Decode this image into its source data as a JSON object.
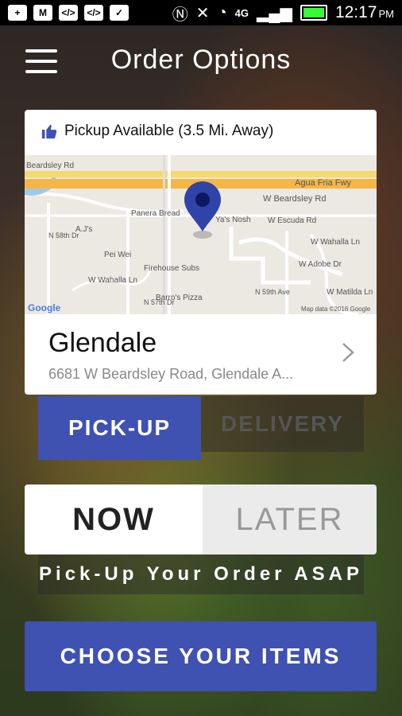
{
  "status_bar": {
    "time": "12:17",
    "ampm": "PM",
    "network": "4G"
  },
  "header": {
    "title": "Order Options",
    "menu_icon": "hamburger-menu-icon"
  },
  "location_card": {
    "pickup_status": "Pickup Available (3.5 Mi. Away)",
    "store_name": "Glendale",
    "store_address": "6681 W Beardsley Road, Glendale A...",
    "map": {
      "streets": [
        "Beardsley Rd",
        "Agua Fria Fwy",
        "W Beardsley Rd",
        "W Escuda Rd",
        "W Wahalla Ln",
        "W Adobe Dr",
        "W Matilda Ln",
        "N 59th Ave",
        "N 57th Dr",
        "N 58th Dr",
        "W Wahalla Ln"
      ],
      "places": [
        "Panera Bread",
        "Pei Wei",
        "A.J's",
        "Firehouse Subs",
        "Barro's Pizza",
        "Ya's Nosh"
      ],
      "attribution": "Map data ©2016 Google",
      "logo": "Google"
    }
  },
  "fulfillment": {
    "pickup_label": "PICK-UP",
    "delivery_label": "DELIVERY",
    "selected": "PICK-UP"
  },
  "timing": {
    "now_label": "NOW",
    "later_label": "LATER",
    "selected": "NOW",
    "message": "Pick-Up Your Order ASAP"
  },
  "cta": {
    "label": "CHOOSE YOUR ITEMS"
  },
  "colors": {
    "accent": "#3f51b1",
    "pin": "#2f43a8"
  }
}
